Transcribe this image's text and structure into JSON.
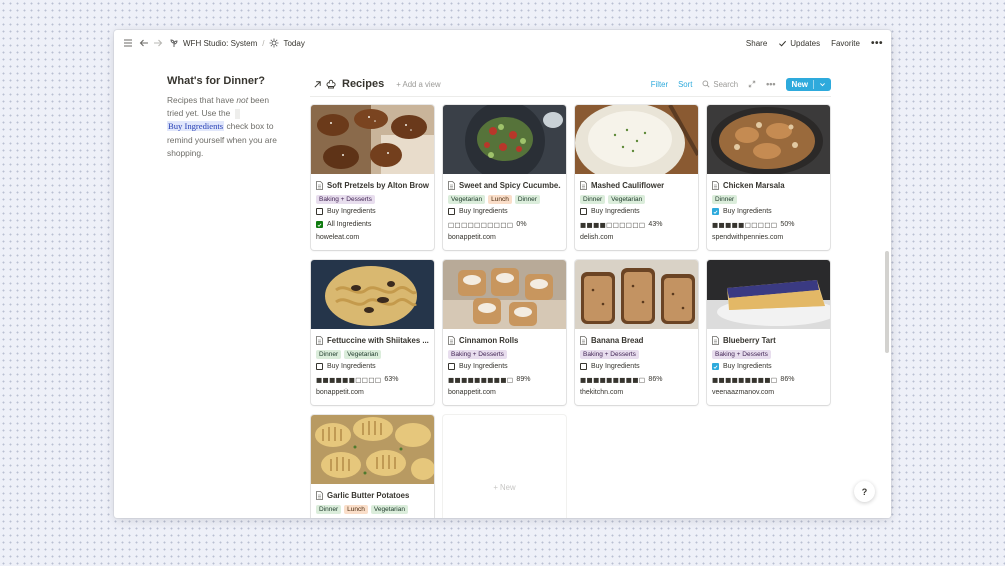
{
  "topbar": {
    "breadcrumb": [
      "WFH Studio: System",
      "Today"
    ],
    "share": "Share",
    "updates": "Updates",
    "favorite": "Favorite",
    "more": "•••"
  },
  "side": {
    "title": "What's for Dinner?",
    "text_a": "Recipes that have ",
    "text_not": "not",
    "text_b": " been tried yet. Use the ",
    "highlight": "Buy Ingredients",
    "text_c": " check box to remind yourself when you are shopping."
  },
  "db": {
    "title": "Recipes",
    "add_view": "+ Add a view",
    "filter": "Filter",
    "sort": "Sort",
    "search": "Search",
    "new": "New"
  },
  "labels": {
    "buy_ingredients": "Buy Ingredients",
    "all_ingredients": "All Ingredients",
    "new_card": "+ New"
  },
  "cards": [
    {
      "title": "Soft Pretzels by Alton Brown",
      "tags": [
        "Baking + Desserts"
      ],
      "buy": false,
      "progress_text": "",
      "all_ingredients": true,
      "source": "howeleat.com"
    },
    {
      "title": "Sweet and Spicy Cucumbe...",
      "tags": [
        "Vegetarian",
        "Lunch",
        "Dinner"
      ],
      "buy": false,
      "progress_text": "0%",
      "progress": 0,
      "source": "bonappetit.com"
    },
    {
      "title": "Mashed Cauliflower",
      "tags": [
        "Dinner",
        "Vegetarian"
      ],
      "buy": false,
      "progress_text": "43%",
      "progress": 43,
      "source": "delish.com"
    },
    {
      "title": "Chicken Marsala",
      "tags": [
        "Dinner"
      ],
      "buy": true,
      "progress_text": "50%",
      "progress": 50,
      "source": "spendwithpennies.com"
    },
    {
      "title": "Fettuccine with Shiitakes ...",
      "tags": [
        "Dinner",
        "Vegetarian"
      ],
      "buy": false,
      "progress_text": "63%",
      "progress": 63,
      "source": "bonappetit.com"
    },
    {
      "title": "Cinnamon Rolls",
      "tags": [
        "Baking + Desserts"
      ],
      "buy": false,
      "progress_text": "89%",
      "progress": 89,
      "source": "bonappetit.com"
    },
    {
      "title": "Banana Bread",
      "tags": [
        "Baking + Desserts"
      ],
      "buy": false,
      "progress_text": "86%",
      "progress": 86,
      "source": "thekitchn.com"
    },
    {
      "title": "Blueberry Tart",
      "tags": [
        "Baking + Desserts"
      ],
      "buy": true,
      "progress_text": "86%",
      "progress": 86,
      "source": "veenaazmanov.com"
    },
    {
      "title": "Garlic Butter Potatoes",
      "tags": [
        "Dinner",
        "Lunch",
        "Vegetarian"
      ]
    }
  ],
  "colors": {
    "accent": "#2eaadc",
    "purple_tag": "#e8deee",
    "green_tag": "#dbeddb",
    "orange_tag": "#fadec9"
  },
  "help": "?"
}
